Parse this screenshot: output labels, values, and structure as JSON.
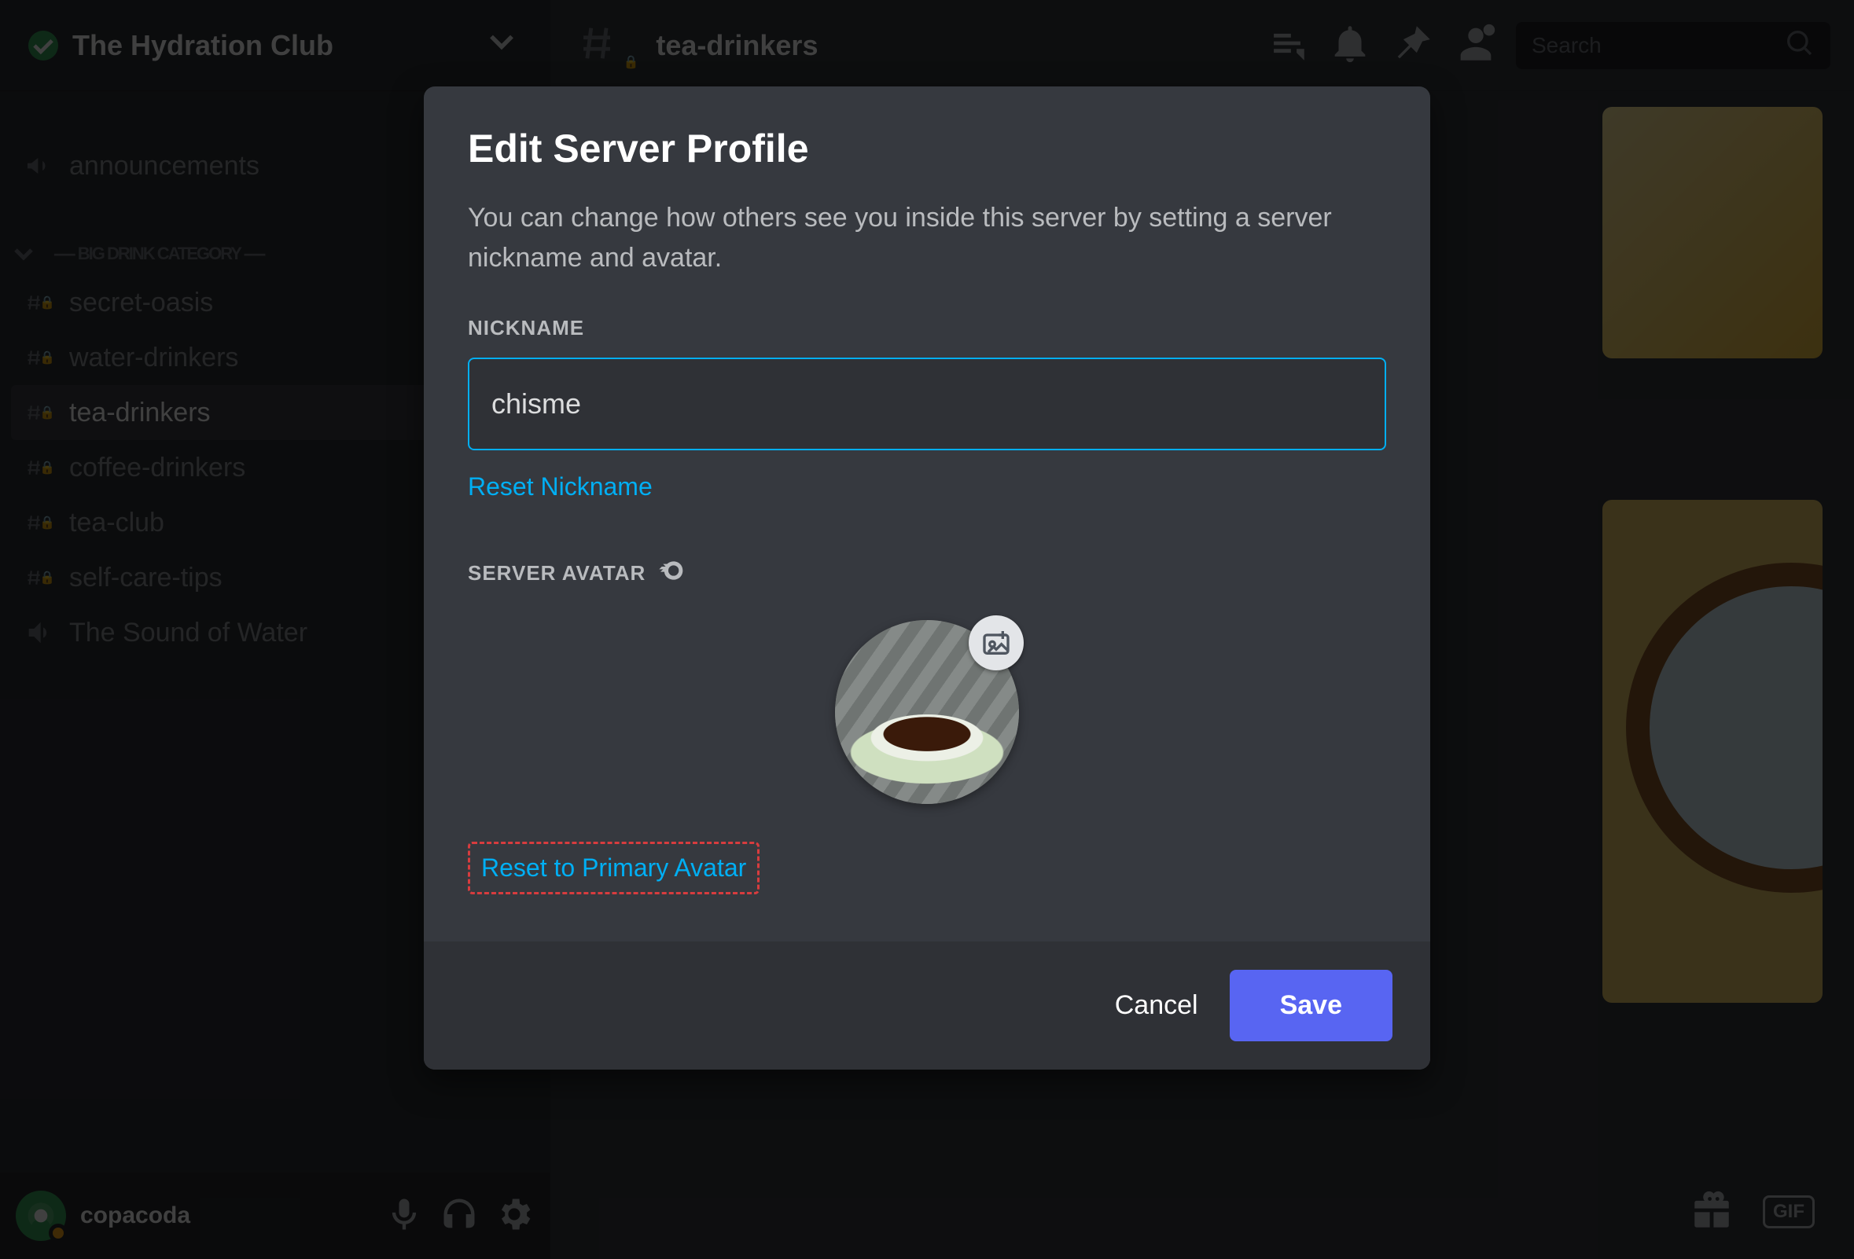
{
  "server": {
    "name": "The Hydration Club",
    "category_label": "----- BIG DRINK CATEGORY -----"
  },
  "sidebar": {
    "announcements_label": "announcements",
    "channels": [
      {
        "name": "secret-oasis",
        "locked": true
      },
      {
        "name": "water-drinkers",
        "locked": true
      },
      {
        "name": "tea-drinkers",
        "locked": true,
        "active": true
      },
      {
        "name": "coffee-drinkers",
        "locked": true
      },
      {
        "name": "tea-club",
        "locked": true
      },
      {
        "name": "self-care-tips",
        "locked": true
      }
    ],
    "voice_channel": "The Sound of Water"
  },
  "user": {
    "name": "copacoda"
  },
  "channel_header": {
    "name": "tea-drinkers",
    "locked": true,
    "search_placeholder": "Search"
  },
  "modal": {
    "title": "Edit Server Profile",
    "description": "You can change how others see you inside this server by setting a server nickname and avatar.",
    "nickname_label": "NICKNAME",
    "nickname_value": "chisme",
    "reset_nickname": "Reset Nickname",
    "server_avatar_label": "SERVER AVATAR",
    "reset_avatar": "Reset to Primary Avatar",
    "cancel": "Cancel",
    "save": "Save"
  },
  "icons": {
    "verify": "verified-check-icon",
    "chevron_down": "chevron-down-icon",
    "megaphone": "megaphone-icon",
    "hash": "hash-icon",
    "lock": "lock-icon",
    "speaker": "speaker-icon",
    "mic": "microphone-icon",
    "headphones": "headphones-icon",
    "gear": "gear-icon",
    "threads": "threads-icon",
    "bell": "bell-icon",
    "pin": "pin-icon",
    "members": "members-icon",
    "search": "search-icon",
    "gift": "gift-icon",
    "gif": "gif-icon",
    "nitro": "nitro-badge-icon",
    "upload_image": "upload-image-icon"
  }
}
